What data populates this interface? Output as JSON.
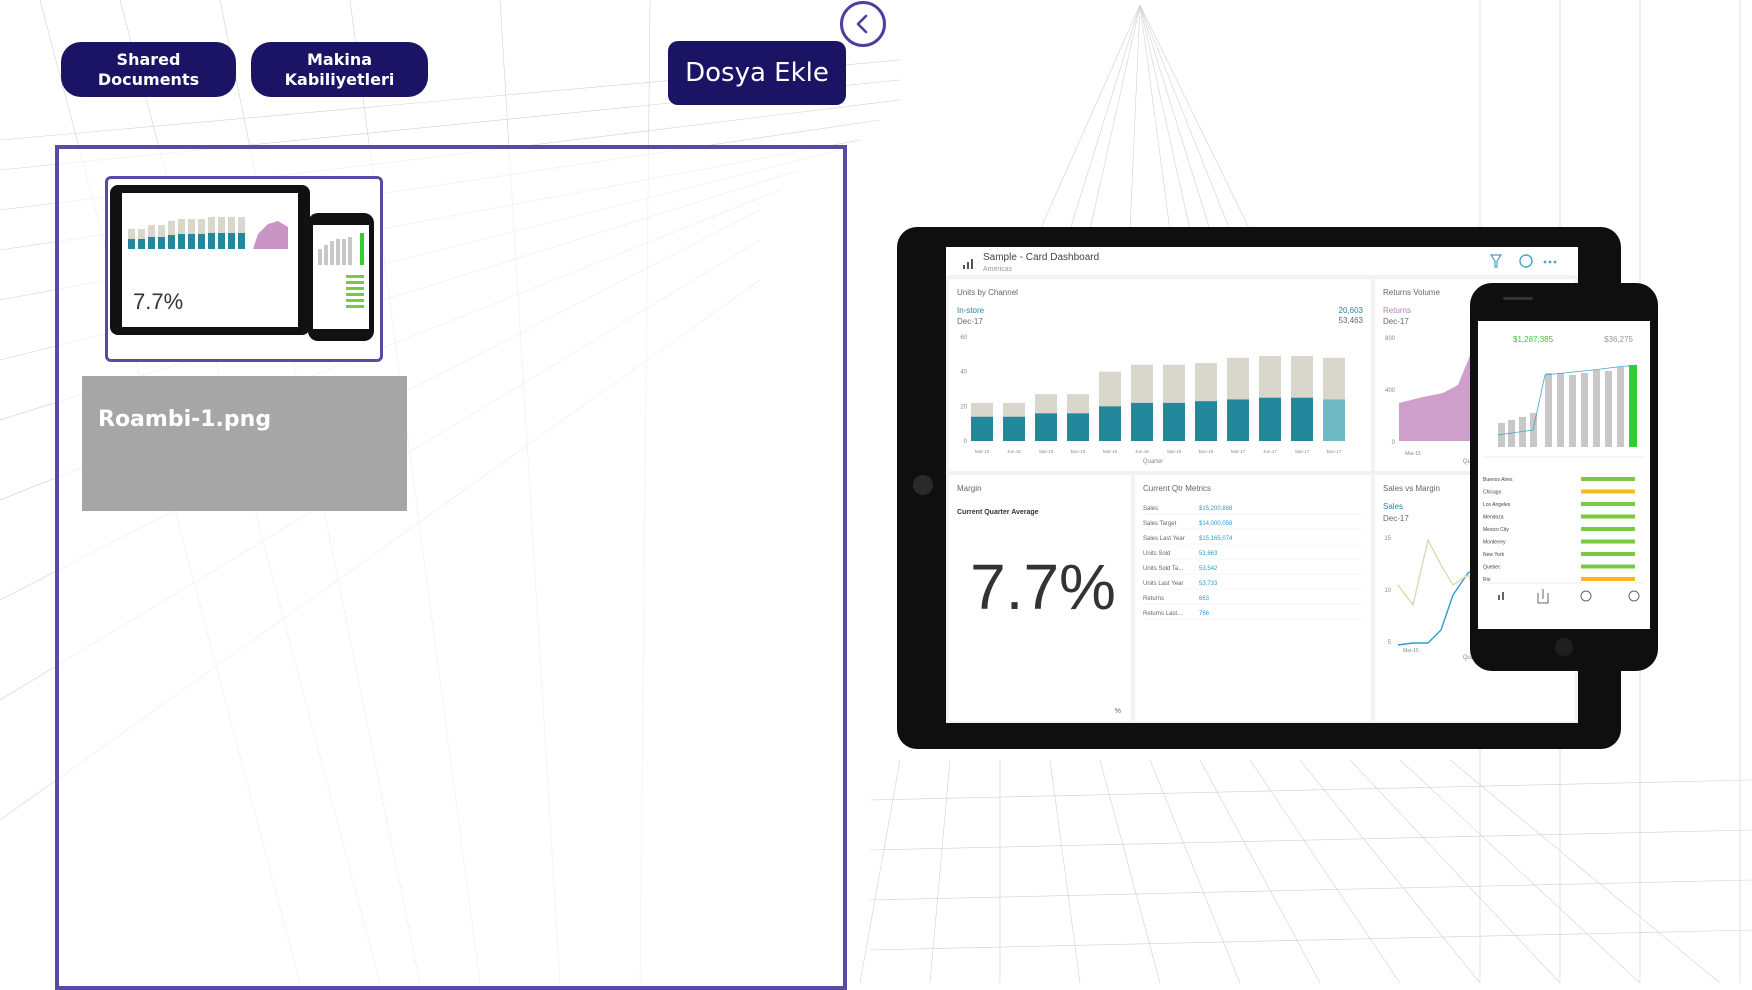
{
  "nav": {
    "shared_documents": "Shared Documents",
    "makina_kabiliyetleri": "Makina Kabiliyetleri",
    "dosya_ekle": "Dosya Ekle",
    "back_icon": "chevron-left-icon"
  },
  "file": {
    "name": "Roambi-1.png"
  },
  "dashboard": {
    "title": "Sample - Card Dashboard",
    "subtitle": "Americas",
    "units_by_channel": {
      "heading": "Units by Channel",
      "series_label": "In-store",
      "period": "Dec-17",
      "value_1": "20,603",
      "value_2": "53,463",
      "x_title": "Quarter",
      "ticks": [
        "Mar-15",
        "Jun-15",
        "Sep-15",
        "Dec-15",
        "Mar-16",
        "Jun-16",
        "Sep-16",
        "Dec-16",
        "Mar-17",
        "Jun-17",
        "Sep-17",
        "Dec-17"
      ],
      "y_ticks": [
        "60",
        "40",
        "20",
        "0"
      ],
      "teal": [
        14,
        14,
        16,
        16,
        20,
        22,
        22,
        23,
        24,
        25,
        25,
        24
      ],
      "total": [
        22,
        22,
        27,
        27,
        40,
        44,
        44,
        45,
        48,
        49,
        49,
        48
      ]
    },
    "returns_volume": {
      "heading": "Returns Volume",
      "series_label": "Returns",
      "period": "Dec-17",
      "y_ticks": [
        "800",
        "400",
        "0"
      ],
      "x_tick": "Mar-15",
      "x_title": "Quarter"
    },
    "margin": {
      "heading": "Margin",
      "sub": "Current Quarter Average",
      "value": "7.7%",
      "unit": "%"
    },
    "current_qtr": {
      "heading": "Current Qtr Metrics",
      "rows": [
        {
          "label": "Sales",
          "value": "$15,200,868"
        },
        {
          "label": "Sales Target",
          "value": "$14,000,058"
        },
        {
          "label": "Sales Last Year",
          "value": "$15,165,074"
        },
        {
          "label": "Units Sold",
          "value": "53,663"
        },
        {
          "label": "Units Sold Ta...",
          "value": "53,542"
        },
        {
          "label": "Units Last Year",
          "value": "53,733"
        },
        {
          "label": "Returns",
          "value": "663"
        },
        {
          "label": "Returns Last...",
          "value": "766"
        }
      ]
    },
    "sales_vs_margin": {
      "heading": "Sales vs Margin",
      "series_label": "Sales",
      "period": "Dec-17",
      "y_ticks": [
        "15",
        "10",
        "5"
      ],
      "x_tick": "Mar-15",
      "x_title": "Quarter"
    },
    "phone": {
      "value_1": "$1,287,385",
      "value_2": "$36,275",
      "cities": [
        "Buenos Aires",
        "Chicago",
        "Los Angeles",
        "Mendoza",
        "Mexico City",
        "Monterrey",
        "New York",
        "Quebec",
        "Rio"
      ]
    }
  },
  "colors": {
    "accent": "#1b1464",
    "border": "#5b4aa3",
    "teal": "#23889b",
    "tan": "#d9d6cc",
    "purple": "#b581b1"
  }
}
